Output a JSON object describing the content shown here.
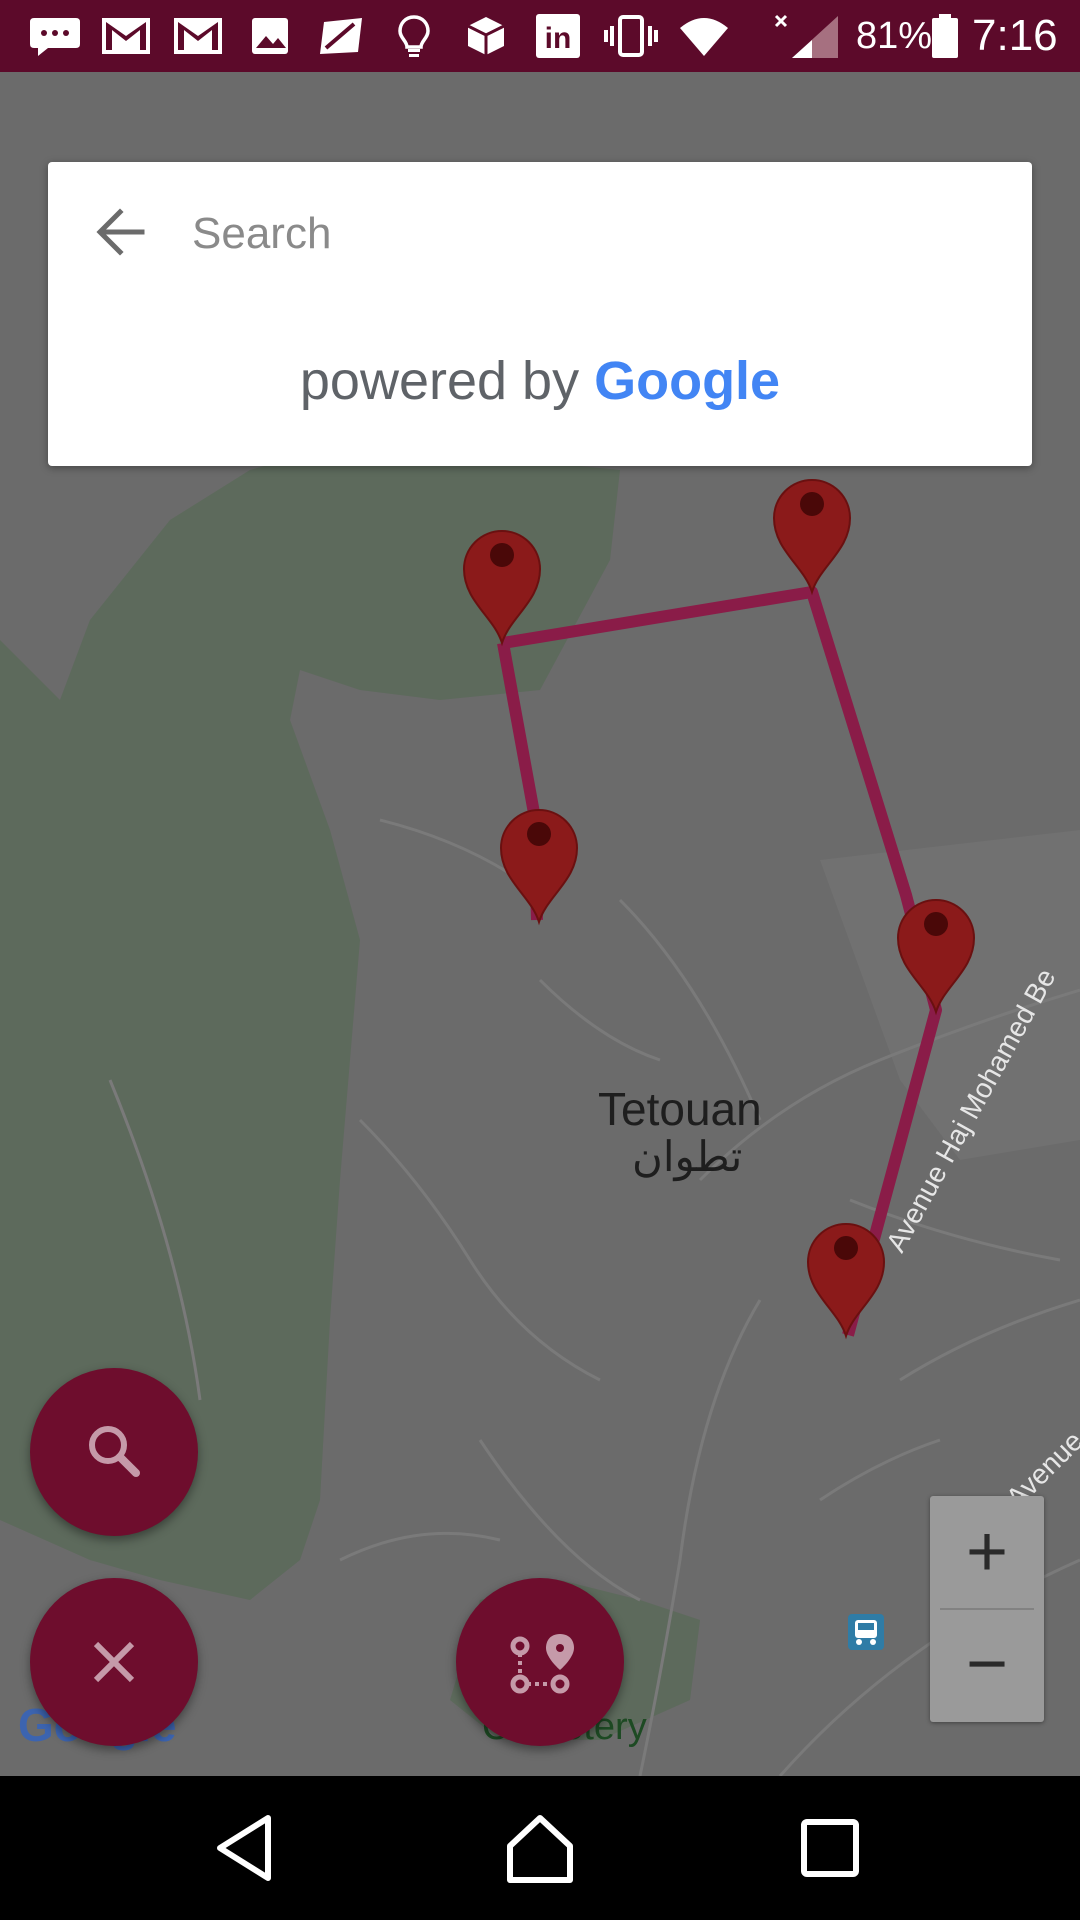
{
  "status_bar": {
    "battery_percent": "81%",
    "time": "7:16",
    "icons": [
      "chat-bubble-icon",
      "gmail-icon",
      "gmail-icon",
      "image-icon",
      "flipboard-icon",
      "lightbulb-icon",
      "box-icon",
      "linkedin-icon",
      "vibrate-icon",
      "wifi-icon",
      "signal-icon",
      "battery-icon"
    ]
  },
  "search": {
    "placeholder": "Search",
    "powered_by": "powered by",
    "brand": "Google"
  },
  "map": {
    "city_label": "Tetouan",
    "city_label_arabic": "تطوان",
    "street_label": "Avenue Haj Mohamed Be",
    "street_label_2": "Avenue d",
    "cemetery_label": "Cemetery",
    "map_logo": "Google",
    "route_color": "#8a1c48",
    "marker_color": "#8b1a1a"
  },
  "fabs": {
    "search_icon": "search-icon",
    "clear_icon": "close-icon",
    "route_icon": "route-icon"
  },
  "zoom": {
    "in": "+",
    "out": "−"
  },
  "nav": {
    "back": "back-icon",
    "home": "home-icon",
    "recents": "recents-icon"
  }
}
